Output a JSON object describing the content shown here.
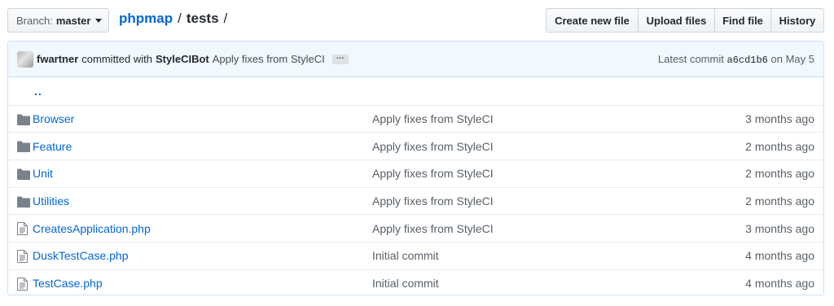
{
  "branch": {
    "label": "Branch:",
    "value": "master"
  },
  "breadcrumb": {
    "repo": "phpmap",
    "separator": "/",
    "current": "tests",
    "trailing": "/"
  },
  "actions": {
    "create_new_file": "Create new file",
    "upload_files": "Upload files",
    "find_file": "Find file",
    "history": "History"
  },
  "commit": {
    "author": "fwartner",
    "committed_with": "committed with",
    "committer": "StyleCIBot",
    "message": "Apply fixes from StyleCI",
    "ellipsis": "…",
    "latest_label": "Latest commit",
    "sha": "a6cd1b6",
    "date": "on May 5"
  },
  "parent_dir": "..",
  "files": [
    {
      "type": "folder",
      "icon": "folder-icon",
      "name": "Browser",
      "message": "Apply fixes from StyleCI",
      "age": "3 months ago"
    },
    {
      "type": "folder",
      "icon": "folder-icon",
      "name": "Feature",
      "message": "Apply fixes from StyleCI",
      "age": "2 months ago"
    },
    {
      "type": "folder",
      "icon": "folder-icon",
      "name": "Unit",
      "message": "Apply fixes from StyleCI",
      "age": "2 months ago"
    },
    {
      "type": "folder",
      "icon": "folder-icon",
      "name": "Utilities",
      "message": "Apply fixes from StyleCI",
      "age": "2 months ago"
    },
    {
      "type": "file",
      "icon": "file-icon",
      "name": "CreatesApplication.php",
      "message": "Apply fixes from StyleCI",
      "age": "3 months ago"
    },
    {
      "type": "file",
      "icon": "file-icon",
      "name": "DuskTestCase.php",
      "message": "Initial commit",
      "age": "4 months ago"
    },
    {
      "type": "file",
      "icon": "file-icon",
      "name": "TestCase.php",
      "message": "Initial commit",
      "age": "4 months ago"
    }
  ],
  "colors": {
    "link": "#0366d6",
    "commit_bar_bg": "#f1f8ff",
    "border": "#c8e1ff",
    "icon": "#79828b"
  }
}
